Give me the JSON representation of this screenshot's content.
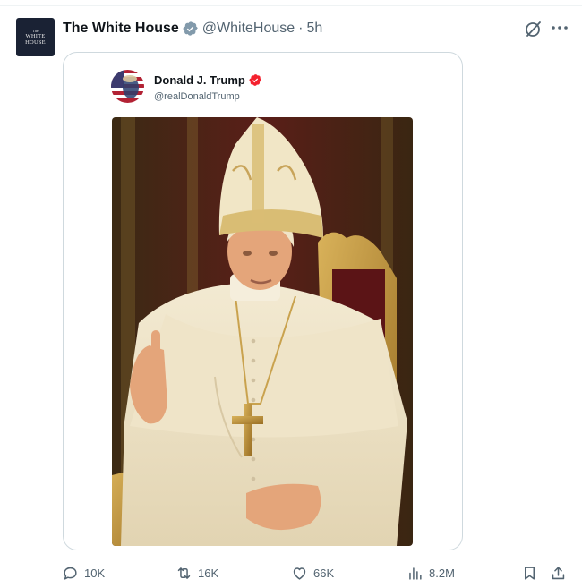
{
  "post": {
    "author": {
      "display_name": "The White House",
      "handle": "@WhiteHouse",
      "time": "5h",
      "separator": "·",
      "avatar_lines": [
        "The",
        "WHITE",
        "HOUSE"
      ],
      "badge": "verified-gov-badge-icon"
    },
    "embedded_post": {
      "display_name": "Donald J. Trump",
      "handle": "@realDonaldTrump",
      "badge": "verified-red-badge-icon",
      "image_alt_icon": "portrait-image"
    },
    "actions": {
      "replies": "10K",
      "reposts": "16K",
      "likes": "66K",
      "views": "8.2M"
    }
  },
  "colors": {
    "text": "#0f1419",
    "muted": "#536471",
    "border": "#cfd9de",
    "badge_gray": "#829aab",
    "badge_red": "#f4212e"
  }
}
